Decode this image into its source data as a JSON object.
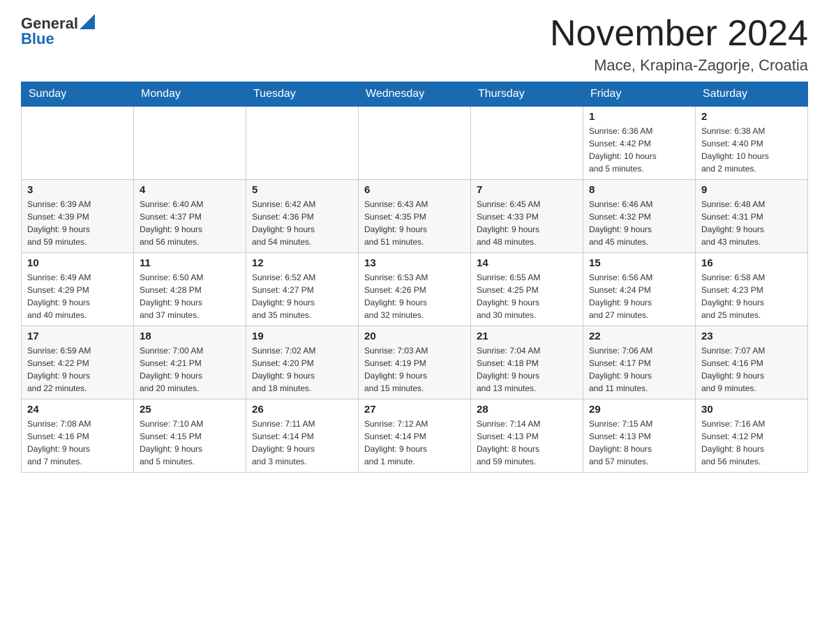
{
  "logo": {
    "general": "General",
    "blue": "Blue"
  },
  "header": {
    "month": "November 2024",
    "location": "Mace, Krapina-Zagorje, Croatia"
  },
  "weekdays": [
    "Sunday",
    "Monday",
    "Tuesday",
    "Wednesday",
    "Thursday",
    "Friday",
    "Saturday"
  ],
  "weeks": [
    [
      {
        "day": "",
        "info": ""
      },
      {
        "day": "",
        "info": ""
      },
      {
        "day": "",
        "info": ""
      },
      {
        "day": "",
        "info": ""
      },
      {
        "day": "",
        "info": ""
      },
      {
        "day": "1",
        "info": "Sunrise: 6:36 AM\nSunset: 4:42 PM\nDaylight: 10 hours\nand 5 minutes."
      },
      {
        "day": "2",
        "info": "Sunrise: 6:38 AM\nSunset: 4:40 PM\nDaylight: 10 hours\nand 2 minutes."
      }
    ],
    [
      {
        "day": "3",
        "info": "Sunrise: 6:39 AM\nSunset: 4:39 PM\nDaylight: 9 hours\nand 59 minutes."
      },
      {
        "day": "4",
        "info": "Sunrise: 6:40 AM\nSunset: 4:37 PM\nDaylight: 9 hours\nand 56 minutes."
      },
      {
        "day": "5",
        "info": "Sunrise: 6:42 AM\nSunset: 4:36 PM\nDaylight: 9 hours\nand 54 minutes."
      },
      {
        "day": "6",
        "info": "Sunrise: 6:43 AM\nSunset: 4:35 PM\nDaylight: 9 hours\nand 51 minutes."
      },
      {
        "day": "7",
        "info": "Sunrise: 6:45 AM\nSunset: 4:33 PM\nDaylight: 9 hours\nand 48 minutes."
      },
      {
        "day": "8",
        "info": "Sunrise: 6:46 AM\nSunset: 4:32 PM\nDaylight: 9 hours\nand 45 minutes."
      },
      {
        "day": "9",
        "info": "Sunrise: 6:48 AM\nSunset: 4:31 PM\nDaylight: 9 hours\nand 43 minutes."
      }
    ],
    [
      {
        "day": "10",
        "info": "Sunrise: 6:49 AM\nSunset: 4:29 PM\nDaylight: 9 hours\nand 40 minutes."
      },
      {
        "day": "11",
        "info": "Sunrise: 6:50 AM\nSunset: 4:28 PM\nDaylight: 9 hours\nand 37 minutes."
      },
      {
        "day": "12",
        "info": "Sunrise: 6:52 AM\nSunset: 4:27 PM\nDaylight: 9 hours\nand 35 minutes."
      },
      {
        "day": "13",
        "info": "Sunrise: 6:53 AM\nSunset: 4:26 PM\nDaylight: 9 hours\nand 32 minutes."
      },
      {
        "day": "14",
        "info": "Sunrise: 6:55 AM\nSunset: 4:25 PM\nDaylight: 9 hours\nand 30 minutes."
      },
      {
        "day": "15",
        "info": "Sunrise: 6:56 AM\nSunset: 4:24 PM\nDaylight: 9 hours\nand 27 minutes."
      },
      {
        "day": "16",
        "info": "Sunrise: 6:58 AM\nSunset: 4:23 PM\nDaylight: 9 hours\nand 25 minutes."
      }
    ],
    [
      {
        "day": "17",
        "info": "Sunrise: 6:59 AM\nSunset: 4:22 PM\nDaylight: 9 hours\nand 22 minutes."
      },
      {
        "day": "18",
        "info": "Sunrise: 7:00 AM\nSunset: 4:21 PM\nDaylight: 9 hours\nand 20 minutes."
      },
      {
        "day": "19",
        "info": "Sunrise: 7:02 AM\nSunset: 4:20 PM\nDaylight: 9 hours\nand 18 minutes."
      },
      {
        "day": "20",
        "info": "Sunrise: 7:03 AM\nSunset: 4:19 PM\nDaylight: 9 hours\nand 15 minutes."
      },
      {
        "day": "21",
        "info": "Sunrise: 7:04 AM\nSunset: 4:18 PM\nDaylight: 9 hours\nand 13 minutes."
      },
      {
        "day": "22",
        "info": "Sunrise: 7:06 AM\nSunset: 4:17 PM\nDaylight: 9 hours\nand 11 minutes."
      },
      {
        "day": "23",
        "info": "Sunrise: 7:07 AM\nSunset: 4:16 PM\nDaylight: 9 hours\nand 9 minutes."
      }
    ],
    [
      {
        "day": "24",
        "info": "Sunrise: 7:08 AM\nSunset: 4:16 PM\nDaylight: 9 hours\nand 7 minutes."
      },
      {
        "day": "25",
        "info": "Sunrise: 7:10 AM\nSunset: 4:15 PM\nDaylight: 9 hours\nand 5 minutes."
      },
      {
        "day": "26",
        "info": "Sunrise: 7:11 AM\nSunset: 4:14 PM\nDaylight: 9 hours\nand 3 minutes."
      },
      {
        "day": "27",
        "info": "Sunrise: 7:12 AM\nSunset: 4:14 PM\nDaylight: 9 hours\nand 1 minute."
      },
      {
        "day": "28",
        "info": "Sunrise: 7:14 AM\nSunset: 4:13 PM\nDaylight: 8 hours\nand 59 minutes."
      },
      {
        "day": "29",
        "info": "Sunrise: 7:15 AM\nSunset: 4:13 PM\nDaylight: 8 hours\nand 57 minutes."
      },
      {
        "day": "30",
        "info": "Sunrise: 7:16 AM\nSunset: 4:12 PM\nDaylight: 8 hours\nand 56 minutes."
      }
    ]
  ]
}
